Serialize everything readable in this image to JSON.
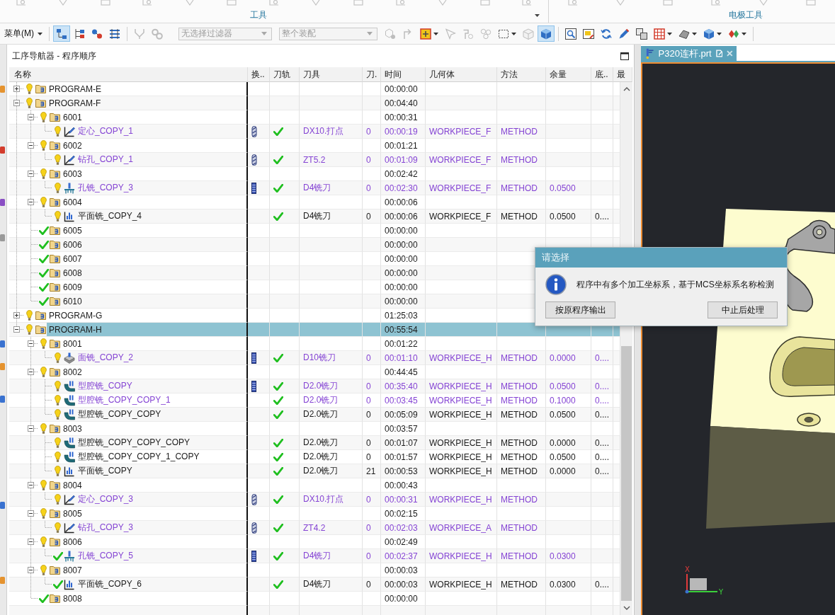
{
  "ribbon": {
    "groups": [
      {
        "label": "工具",
        "menu": true
      },
      {
        "label": "电极工具"
      }
    ]
  },
  "toolbar": {
    "menu": "菜单(M)",
    "groups": [
      {
        "tools": [
          {
            "kind": "boxes",
            "pressed": true,
            "disabled": false,
            "dropdown": false
          },
          {
            "kind": "branches",
            "pressed": false,
            "disabled": false,
            "dropdown": false
          },
          {
            "kind": "balls",
            "pressed": false,
            "disabled": false,
            "dropdown": false
          },
          {
            "kind": "racks",
            "pressed": false,
            "disabled": false,
            "dropdown": false
          }
        ]
      },
      {
        "tools": [
          {
            "kind": "forks",
            "pressed": false,
            "disabled": true,
            "dropdown": false
          },
          {
            "kind": "gears",
            "pressed": false,
            "disabled": true,
            "dropdown": false
          }
        ]
      },
      {
        "fields": [
          {
            "value": "无选择过滤器",
            "disabled": true
          },
          {
            "value": "整个装配",
            "disabled": true
          }
        ]
      },
      {
        "tools": [
          {
            "kind": "parts",
            "pressed": false,
            "disabled": true,
            "dropdown": false
          },
          {
            "kind": "arrows",
            "pressed": false,
            "disabled": true,
            "dropdown": false
          },
          {
            "kind": "target",
            "pressed": false,
            "disabled": false,
            "dropdown": true
          },
          {
            "kind": "pointer",
            "pressed": false,
            "disabled": true,
            "dropdown": false
          },
          {
            "kind": "clamp",
            "pressed": false,
            "disabled": true,
            "dropdown": false
          },
          {
            "kind": "cluster",
            "pressed": false,
            "disabled": true,
            "dropdown": false
          },
          {
            "kind": "frame",
            "pressed": false,
            "disabled": false,
            "dropdown": true
          },
          {
            "kind": "box",
            "pressed": false,
            "disabled": true,
            "dropdown": false
          },
          {
            "kind": "cube",
            "pressed": true,
            "disabled": false,
            "dropdown": false
          }
        ]
      },
      {
        "tools": [
          {
            "kind": "magnifier",
            "pressed": false,
            "disabled": false,
            "dropdown": false
          },
          {
            "kind": "window",
            "pressed": false,
            "disabled": false,
            "dropdown": false
          },
          {
            "kind": "refresh",
            "pressed": false,
            "disabled": false,
            "dropdown": false
          },
          {
            "kind": "pencil",
            "pressed": false,
            "disabled": false,
            "dropdown": false
          },
          {
            "kind": "layers",
            "pressed": false,
            "disabled": false,
            "dropdown": false
          },
          {
            "kind": "grid",
            "pressed": false,
            "disabled": false,
            "dropdown": true
          },
          {
            "kind": "hat",
            "pressed": false,
            "disabled": false,
            "dropdown": true
          },
          {
            "kind": "cube",
            "pressed": false,
            "disabled": false,
            "dropdown": true
          },
          {
            "kind": "shapes",
            "pressed": false,
            "disabled": false,
            "dropdown": true
          }
        ]
      }
    ]
  },
  "navigator": {
    "title": "工序导航器 - 程序顺序",
    "columns": [
      "名称",
      "换..",
      "刀轨",
      "刀具",
      "刀.",
      "时间",
      "几何体",
      "方法",
      "余量",
      "底..",
      "最"
    ],
    "tree": [
      {
        "name": "PROGRAM-E",
        "kind": "program",
        "complete": false,
        "expanded": false,
        "selected": false,
        "emphasized": false,
        "time": "00:00:00"
      },
      {
        "name": "PROGRAM-F",
        "kind": "program",
        "complete": false,
        "expanded": true,
        "selected": false,
        "emphasized": false,
        "time": "00:04:40",
        "children": [
          {
            "name": "6001",
            "kind": "program",
            "complete": false,
            "expanded": true,
            "selected": false,
            "emphasized": false,
            "time": "00:00:31",
            "children": [
              {
                "name": "定心_COPY_1",
                "kind": "drilling",
                "complete": false,
                "selected": false,
                "emphasized": true,
                "column_2": {
                  "kind": "drill"
                },
                "toolpath": true,
                "tool": "DX10.打点",
                "column_5": "0",
                "time": "00:00:19",
                "geometry": "WORKPIECE_F",
                "method": "METHOD"
              }
            ]
          },
          {
            "name": "6002",
            "kind": "program",
            "complete": false,
            "expanded": true,
            "selected": false,
            "emphasized": false,
            "time": "00:01:21",
            "children": [
              {
                "name": "钻孔_COPY_1",
                "kind": "drilling",
                "complete": false,
                "selected": false,
                "emphasized": true,
                "column_2": {
                  "kind": "drill"
                },
                "toolpath": true,
                "tool": "ZT5.2",
                "column_5": "0",
                "time": "00:01:09",
                "geometry": "WORKPIECE_F",
                "method": "METHOD"
              }
            ]
          },
          {
            "name": "6003",
            "kind": "program",
            "complete": false,
            "expanded": true,
            "selected": false,
            "emphasized": false,
            "time": "00:02:42",
            "children": [
              {
                "name": "孔铣_COPY_3",
                "kind": "hole_milling",
                "complete": false,
                "selected": false,
                "emphasized": true,
                "column_2": {
                  "kind": "mill"
                },
                "toolpath": true,
                "tool": "D4铣刀",
                "column_5": "0",
                "time": "00:02:30",
                "geometry": "WORKPIECE_F",
                "method": "METHOD",
                "stock": "0.0500"
              }
            ]
          },
          {
            "name": "6004",
            "kind": "program",
            "complete": false,
            "expanded": true,
            "selected": false,
            "emphasized": false,
            "time": "00:00:06",
            "children": [
              {
                "name": "平面铣_COPY_4",
                "kind": "planar_milling",
                "complete": false,
                "selected": false,
                "emphasized": false,
                "toolpath": true,
                "tool": "D4铣刀",
                "column_5": "0",
                "time": "00:00:06",
                "geometry": "WORKPIECE_F",
                "method": "METHOD",
                "stock": "0.0500",
                "column_10": "0...."
              }
            ]
          },
          {
            "name": "6005",
            "kind": "program",
            "complete": true,
            "selected": false,
            "emphasized": false,
            "time": "00:00:00"
          },
          {
            "name": "6006",
            "kind": "program",
            "complete": true,
            "selected": false,
            "emphasized": false,
            "time": "00:00:00"
          },
          {
            "name": "6007",
            "kind": "program",
            "complete": true,
            "selected": false,
            "emphasized": false,
            "time": "00:00:00"
          },
          {
            "name": "6008",
            "kind": "program",
            "complete": true,
            "selected": false,
            "emphasized": false,
            "time": "00:00:00"
          },
          {
            "name": "6009",
            "kind": "program",
            "complete": true,
            "selected": false,
            "emphasized": false,
            "time": "00:00:00"
          },
          {
            "name": "6010",
            "kind": "program",
            "complete": true,
            "selected": false,
            "emphasized": false,
            "time": "00:00:00"
          }
        ]
      },
      {
        "name": "PROGRAM-G",
        "kind": "program",
        "complete": false,
        "expanded": false,
        "selected": false,
        "emphasized": false,
        "time": "01:25:03"
      },
      {
        "name": "PROGRAM-H",
        "kind": "program",
        "complete": false,
        "expanded": true,
        "selected": true,
        "emphasized": false,
        "time": "00:55:54",
        "children": [
          {
            "name": "8001",
            "kind": "program",
            "complete": false,
            "expanded": true,
            "selected": false,
            "emphasized": false,
            "time": "00:01:22",
            "children": [
              {
                "name": "面铣_COPY_2",
                "kind": "face_milling",
                "complete": false,
                "selected": false,
                "emphasized": true,
                "column_2": {
                  "kind": "mill"
                },
                "toolpath": true,
                "tool": "D10铣刀",
                "column_5": "0",
                "time": "00:01:10",
                "geometry": "WORKPIECE_H",
                "method": "METHOD",
                "stock": "0.0000",
                "column_10": "0...."
              }
            ]
          },
          {
            "name": "8002",
            "kind": "program",
            "complete": false,
            "expanded": true,
            "selected": false,
            "emphasized": false,
            "time": "00:44:45",
            "children": [
              {
                "name": "型腔铣_COPY",
                "kind": "cavity_milling",
                "complete": false,
                "selected": false,
                "emphasized": true,
                "column_2": {
                  "kind": "mill"
                },
                "toolpath": true,
                "tool": "D2.0铣刀",
                "column_5": "0",
                "time": "00:35:40",
                "geometry": "WORKPIECE_H",
                "method": "METHOD",
                "stock": "0.0500",
                "column_10": "0...."
              },
              {
                "name": "型腔铣_COPY_COPY_1",
                "kind": "cavity_milling",
                "complete": false,
                "selected": false,
                "emphasized": true,
                "toolpath": true,
                "tool": "D2.0铣刀",
                "column_5": "0",
                "time": "00:03:45",
                "geometry": "WORKPIECE_H",
                "method": "METHOD",
                "stock": "0.1000",
                "column_10": "0...."
              },
              {
                "name": "型腔铣_COPY_COPY",
                "kind": "cavity_milling",
                "complete": false,
                "selected": false,
                "emphasized": false,
                "toolpath": true,
                "tool": "D2.0铣刀",
                "column_5": "0",
                "time": "00:05:09",
                "geometry": "WORKPIECE_H",
                "method": "METHOD",
                "stock": "0.0500",
                "column_10": "0...."
              }
            ]
          },
          {
            "name": "8003",
            "kind": "program",
            "complete": false,
            "expanded": true,
            "selected": false,
            "emphasized": false,
            "time": "00:03:57",
            "children": [
              {
                "name": "型腔铣_COPY_COPY_COPY",
                "kind": "cavity_milling",
                "complete": false,
                "selected": false,
                "emphasized": false,
                "toolpath": true,
                "tool": "D2.0铣刀",
                "column_5": "0",
                "time": "00:01:07",
                "geometry": "WORKPIECE_H",
                "method": "METHOD",
                "stock": "0.0000",
                "column_10": "0...."
              },
              {
                "name": "型腔铣_COPY_COPY_1_COPY",
                "kind": "cavity_milling",
                "complete": false,
                "selected": false,
                "emphasized": false,
                "toolpath": true,
                "tool": "D2.0铣刀",
                "column_5": "0",
                "time": "00:01:57",
                "geometry": "WORKPIECE_H",
                "method": "METHOD",
                "stock": "0.0500",
                "column_10": "0...."
              },
              {
                "name": "平面铣_COPY",
                "kind": "planar_milling",
                "complete": false,
                "selected": false,
                "emphasized": false,
                "toolpath": true,
                "tool": "D2.0铣刀",
                "column_5": "21",
                "time": "00:00:53",
                "geometry": "WORKPIECE_H",
                "method": "METHOD",
                "stock": "0.0000",
                "column_10": "0...."
              }
            ]
          },
          {
            "name": "8004",
            "kind": "program",
            "complete": false,
            "expanded": true,
            "selected": false,
            "emphasized": false,
            "time": "00:00:43",
            "children": [
              {
                "name": "定心_COPY_3",
                "kind": "drilling",
                "complete": false,
                "selected": false,
                "emphasized": true,
                "column_2": {
                  "kind": "drill"
                },
                "toolpath": true,
                "tool": "DX10.打点",
                "column_5": "0",
                "time": "00:00:31",
                "geometry": "WORKPIECE_H",
                "method": "METHOD"
              }
            ]
          },
          {
            "name": "8005",
            "kind": "program",
            "complete": false,
            "expanded": true,
            "selected": false,
            "emphasized": false,
            "time": "00:02:15",
            "children": [
              {
                "name": "钻孔_COPY_3",
                "kind": "drilling",
                "complete": false,
                "selected": false,
                "emphasized": true,
                "column_2": {
                  "kind": "drill"
                },
                "toolpath": true,
                "tool": "ZT4.2",
                "column_5": "0",
                "time": "00:02:03",
                "geometry": "WORKPIECE_A",
                "method": "METHOD"
              }
            ]
          },
          {
            "name": "8006",
            "kind": "program",
            "complete": false,
            "expanded": true,
            "selected": false,
            "emphasized": false,
            "time": "00:02:49",
            "children": [
              {
                "name": "孔铣_COPY_5",
                "kind": "hole_milling",
                "complete": true,
                "selected": false,
                "emphasized": true,
                "column_2": {
                  "kind": "mill"
                },
                "toolpath": true,
                "tool": "D4铣刀",
                "column_5": "0",
                "time": "00:02:37",
                "geometry": "WORKPIECE_H",
                "method": "METHOD",
                "stock": "0.0300"
              }
            ]
          },
          {
            "name": "8007",
            "kind": "program",
            "complete": false,
            "expanded": true,
            "selected": false,
            "emphasized": false,
            "time": "00:00:03",
            "children": [
              {
                "name": "平面铣_COPY_6",
                "kind": "planar_milling",
                "complete": true,
                "selected": false,
                "emphasized": false,
                "toolpath": true,
                "tool": "D4铣刀",
                "column_5": "0",
                "time": "00:00:03",
                "geometry": "WORKPIECE_H",
                "method": "METHOD",
                "stock": "0.0300",
                "column_10": "0...."
              }
            ]
          },
          {
            "name": "8008",
            "kind": "program",
            "complete": true,
            "selected": false,
            "emphasized": false,
            "time": "00:00:00"
          }
        ]
      }
    ]
  },
  "document_tab": {
    "label": "P320连杆.prt",
    "selected": true
  },
  "viewport": {
    "x_axis": "X",
    "y_axis": "Y"
  },
  "dialog": {
    "title": "请选择",
    "message": "程序中有多个加工坐标系，基于MCS坐标系名称检测",
    "buttons": [
      "按原程序输出",
      "中止后处理"
    ]
  }
}
